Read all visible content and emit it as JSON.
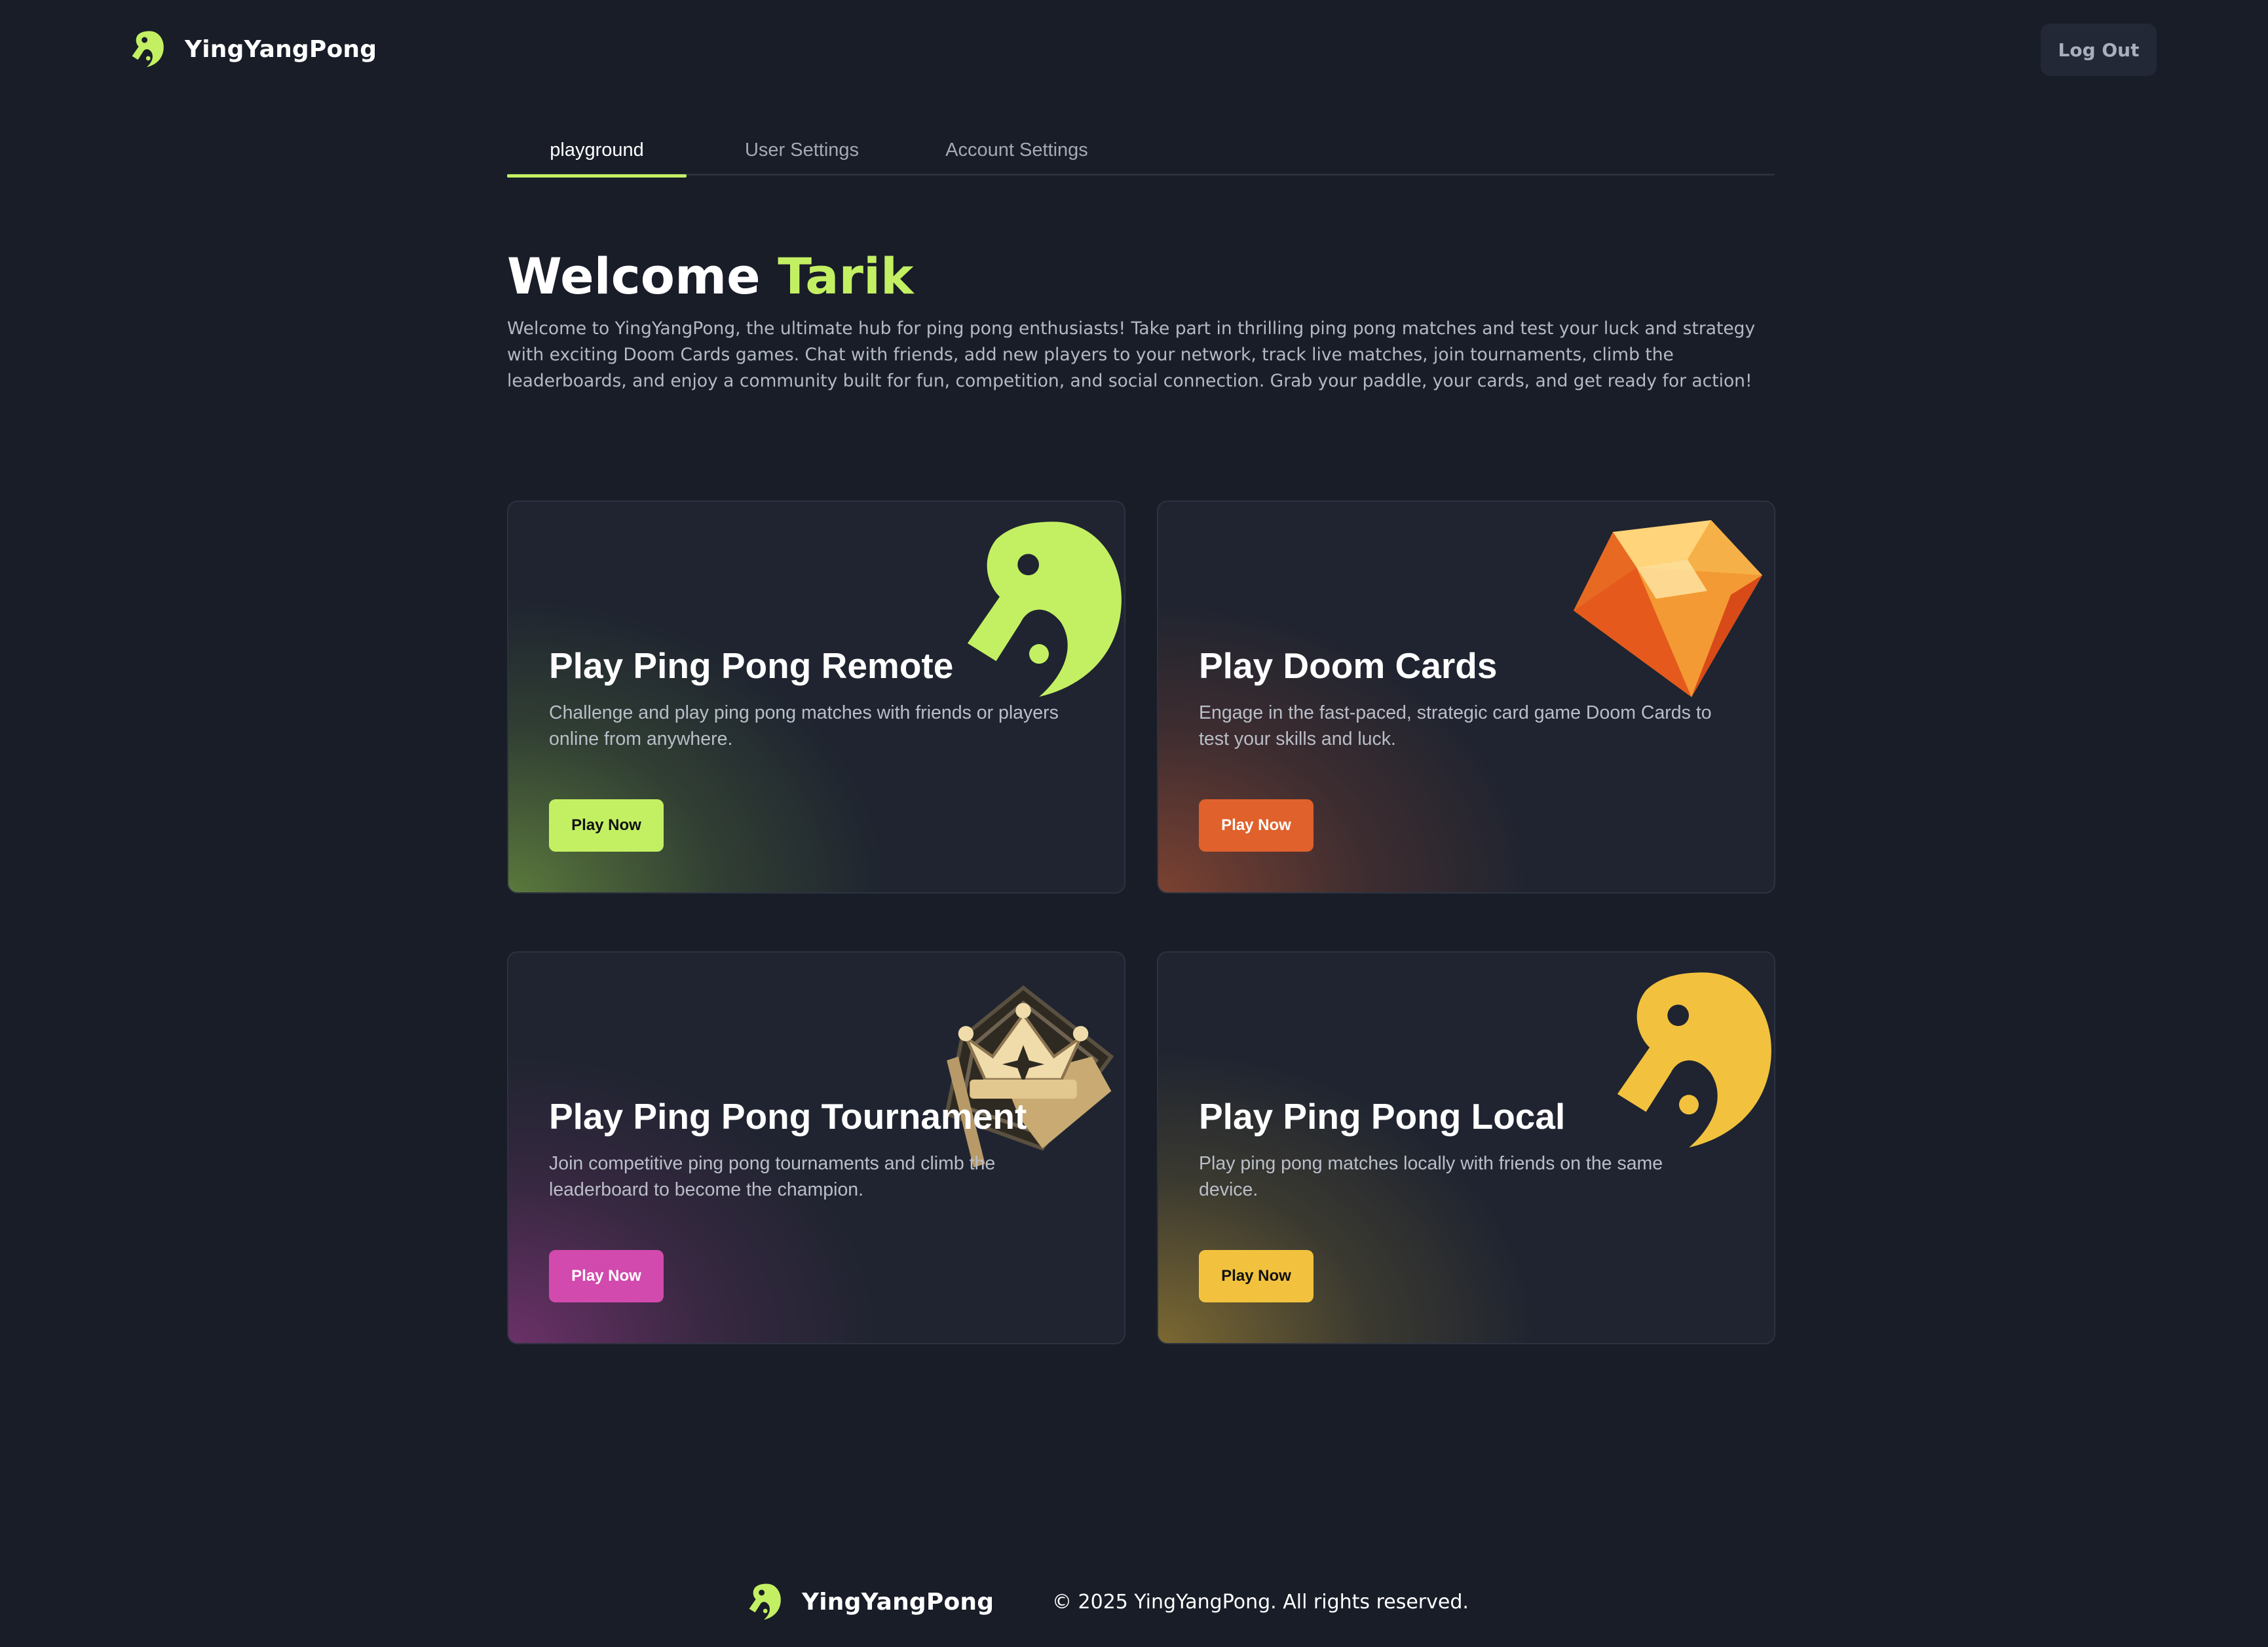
{
  "brand": {
    "name": "YingYangPong",
    "accent": "#c3f063"
  },
  "header": {
    "logout_label": "Log Out"
  },
  "tabs": [
    {
      "label": "playground",
      "active": true
    },
    {
      "label": "User Settings",
      "active": false
    },
    {
      "label": "Account Settings",
      "active": false
    }
  ],
  "welcome": {
    "greeting": "Welcome",
    "user_name": "Tarik",
    "intro": "Welcome to YingYangPong, the ultimate hub for ping pong enthusiasts! Take part in thrilling ping pong matches and test your luck and strategy with exciting Doom Cards games. Chat with friends, add new players to your network, track live matches, join tournaments, climb the leaderboards, and enjoy a community built for fun, competition, and social connection. Grab your paddle, your cards, and get ready for action!"
  },
  "cards": [
    {
      "title": "Play Ping Pong Remote",
      "description": "Challenge and play ping pong matches with friends or players online from anywhere.",
      "button_label": "Play Now",
      "color": "#c3f063",
      "icon": "paddle-icon"
    },
    {
      "title": "Play Doom Cards",
      "description": "Engage in the fast-paced, strategic card game Doom Cards to test your skills and luck.",
      "button_label": "Play Now",
      "color": "#e0612c",
      "icon": "gem-icon"
    },
    {
      "title": "Play Ping Pong Tournament",
      "description": "Join competitive ping pong tournaments and climb the leaderboard to become the champion.",
      "button_label": "Play Now",
      "color": "#d24aad",
      "icon": "crown-icon"
    },
    {
      "title": "Play Ping Pong Local",
      "description": "Play ping pong matches locally with friends on the same device.",
      "button_label": "Play Now",
      "color": "#f2c23e",
      "icon": "paddle-icon"
    }
  ],
  "footer": {
    "brand": "YingYangPong",
    "copyright": "© 2025 YingYangPong. All rights reserved."
  }
}
